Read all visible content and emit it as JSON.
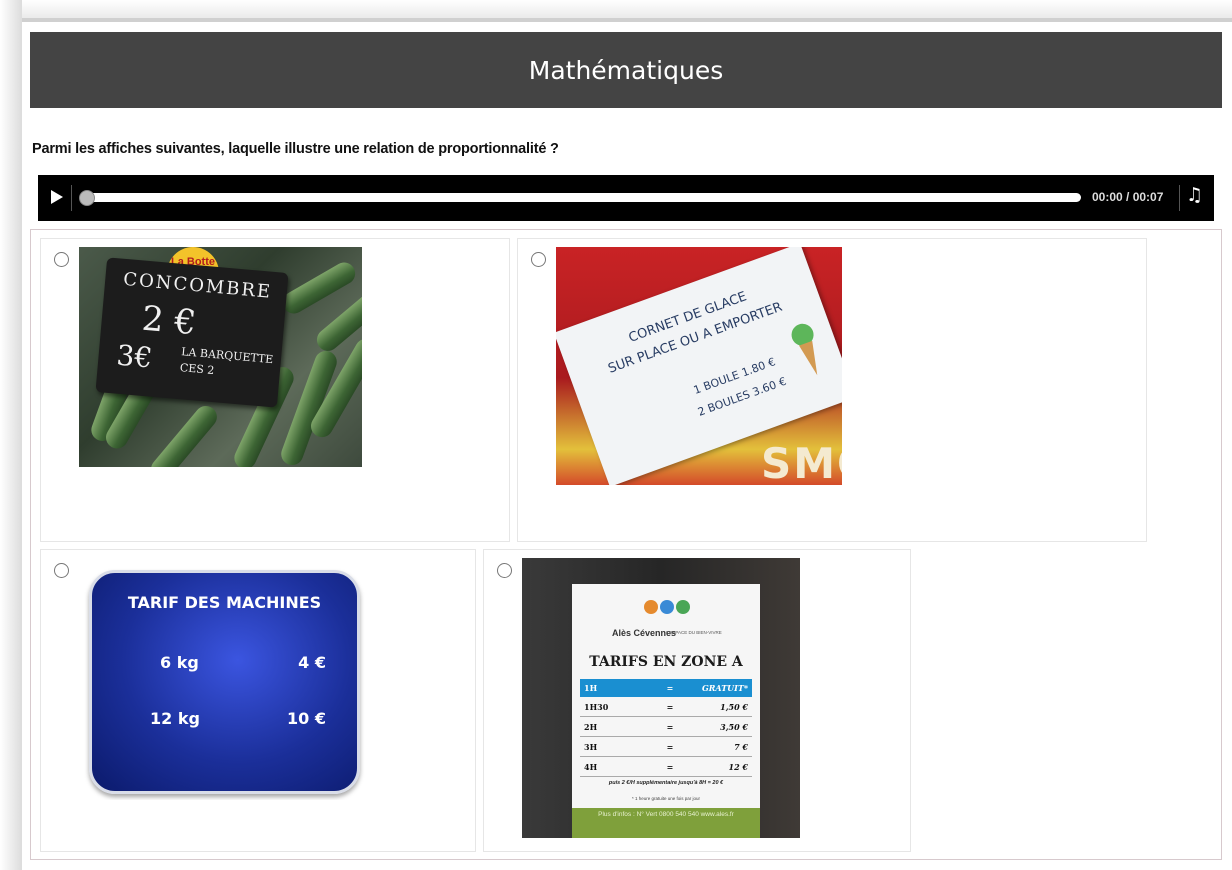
{
  "header": {
    "title": "Mathématiques"
  },
  "question": "Parmi les affiches suivantes, laquelle illustre une relation de proportionnalité ?",
  "audio": {
    "time": "00:00 / 00:07",
    "progress": 0,
    "play_icon": "play-icon",
    "music_icon": "music-note-icon"
  },
  "options": [
    {
      "id": "a",
      "sign": {
        "title": "CONCOMBRE",
        "price1": "2 €",
        "price2": "3€",
        "note": "LA BARQUETTE CES 2",
        "badge": "La Botte"
      }
    },
    {
      "id": "b",
      "sign": {
        "line1": "CORNET DE GLACE",
        "line2": "SUR PLACE OU A EMPORTER",
        "line3": "1 BOULE 1.80 €",
        "line4": "2 BOULES 3.60 €",
        "bg_text": "SMOO"
      }
    },
    {
      "id": "c",
      "sign": {
        "title": "TARIF DES MACHINES",
        "rows": [
          {
            "weight": "6 kg",
            "price": "4 €"
          },
          {
            "weight": "12 kg",
            "price": "10 €"
          }
        ]
      }
    },
    {
      "id": "d",
      "sign": {
        "brand": "Alès Cévennes",
        "brand_sub": "L'ESPACE DU BIEN-VIVRE",
        "title": "TARIFS EN ZONE A",
        "rows": [
          {
            "duration": "1H",
            "eq": "=",
            "price": "GRATUIT*"
          },
          {
            "duration": "1H30",
            "eq": "=",
            "price": "1,50 €"
          },
          {
            "duration": "2H",
            "eq": "=",
            "price": "3,50 €"
          },
          {
            "duration": "3H",
            "eq": "=",
            "price": "7 €"
          },
          {
            "duration": "4H",
            "eq": "=",
            "price": "12 €"
          }
        ],
        "footnote1": "puis 2 €/H supplémentaire jusqu'à 8H = 20 €",
        "footnote2": "* 1 heure gratuite une fois par jour",
        "info": "Plus d'infos : N° Vert 0800 540 540 www.ales.fr"
      }
    }
  ],
  "colors": {
    "header_bg": "#444444",
    "audio_bg": "#000000",
    "answers_border": "#d7c9cd",
    "machine_blue": "#1b2f9a",
    "parking_blue": "#1a8fd1",
    "parking_green": "#7fa03b"
  }
}
